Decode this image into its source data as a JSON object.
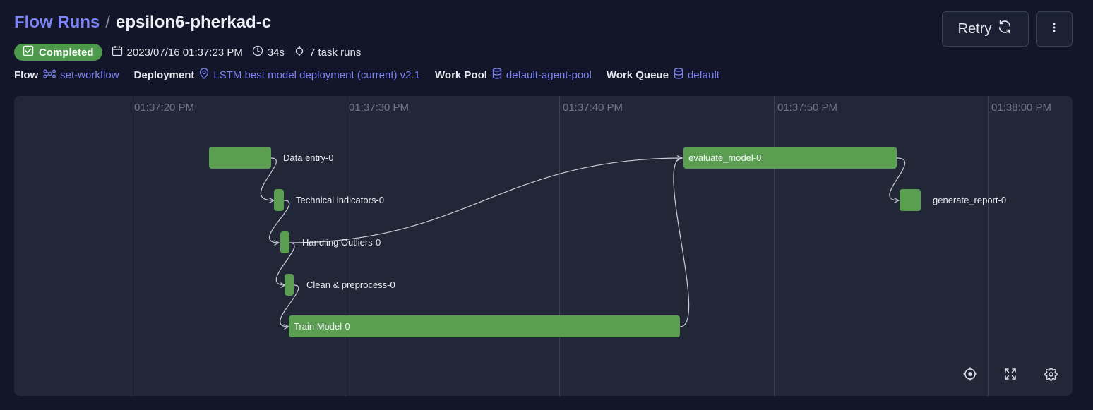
{
  "breadcrumb": {
    "root": "Flow Runs",
    "separator": "/",
    "current": "epsilon6-pherkad-c"
  },
  "actions": {
    "retry_label": "Retry",
    "retry_icon": "refresh-icon",
    "more_icon": "vertical-dots-icon"
  },
  "status": {
    "label": "Completed",
    "color": "#4e9a4c",
    "icon": "check-square-icon"
  },
  "meta": {
    "start_time": "2023/07/16 01:37:23 PM",
    "duration": "34s",
    "task_runs": "7 task runs"
  },
  "info": {
    "flow_label": "Flow",
    "flow_value": "set-workflow",
    "deployment_label": "Deployment",
    "deployment_value": "LSTM best model deployment (current) v2.1",
    "work_pool_label": "Work Pool",
    "work_pool_value": "default-agent-pool",
    "work_queue_label": "Work Queue",
    "work_queue_value": "default"
  },
  "timeline": {
    "ticks": [
      "01:37:20 PM",
      "01:37:30 PM",
      "01:37:40 PM",
      "01:37:50 PM",
      "01:38:00 PM"
    ],
    "tasks": [
      {
        "name": "Data entry-0",
        "start": "01:37:23.7",
        "end": "01:37:26.6"
      },
      {
        "name": "Technical indicators-0",
        "start": "01:37:27.0",
        "end": "01:37:27.5"
      },
      {
        "name": "Handling Outliers-0",
        "start": "01:37:27.5",
        "end": "01:37:28.0"
      },
      {
        "name": "Clean & preprocess-0",
        "start": "01:37:27.7",
        "end": "01:37:28.2"
      },
      {
        "name": "Train Model-0",
        "start": "01:37:27.8",
        "end": "01:37:46.1"
      },
      {
        "name": "evaluate_model-0",
        "start": "01:37:46.2",
        "end": "01:37:56.1"
      },
      {
        "name": "generate_report-0",
        "start": "01:37:56.4",
        "end": "01:37:57.4"
      }
    ],
    "bar_color": "#5b9e52",
    "controls": [
      "crosshair-icon",
      "fullscreen-icon",
      "settings-gear-icon"
    ]
  }
}
